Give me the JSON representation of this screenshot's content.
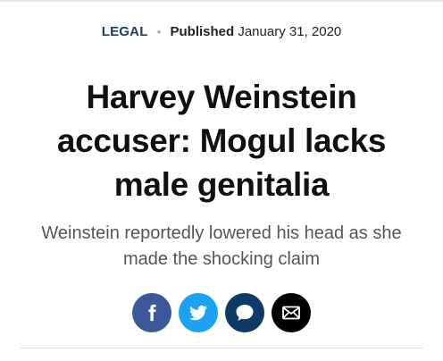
{
  "article": {
    "category": "LEGAL",
    "separator": "•",
    "published_label": "Published",
    "published_date": "January 31, 2020",
    "headline": "Harvey Weinstein accuser: Mogul lacks male genitalia",
    "subheadline": "Weinstein reportedly lowered his head as she made the shocking claim"
  },
  "share": {
    "buttons": [
      {
        "network": "facebook",
        "icon": "facebook-icon",
        "color": "#3b5998"
      },
      {
        "network": "twitter",
        "icon": "twitter-bird-icon",
        "color": "#1da1f2"
      },
      {
        "network": "comments",
        "icon": "speech-bubble-icon",
        "color": "#0d3b66"
      },
      {
        "network": "email",
        "icon": "envelope-icon",
        "color": "#000000"
      }
    ]
  },
  "colors": {
    "category": "#1b3b6f",
    "headline": "#111111",
    "subheadline": "#555555"
  }
}
